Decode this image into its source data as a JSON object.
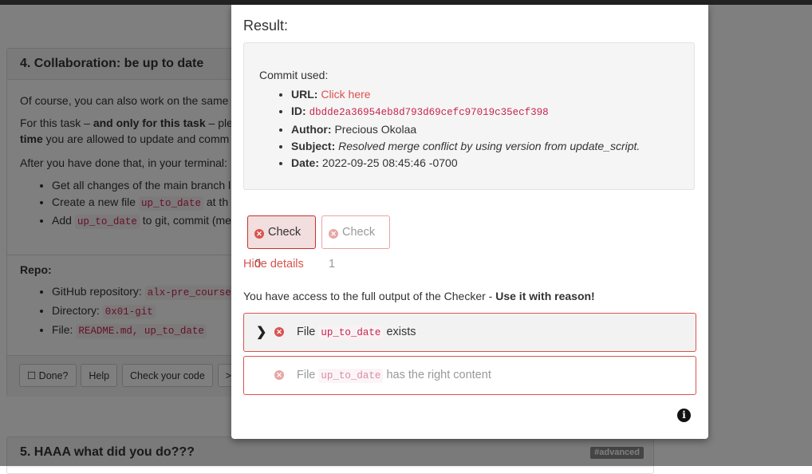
{
  "background": {
    "section4": {
      "title": "4. Collaboration: be up to date",
      "intro": "Of course, you can also work on the same",
      "task_prefix": "For this task – ",
      "task_bold": "and only for this task",
      "task_rest": " – plea",
      "task_line2_bold": "time",
      "task_line2_rest": " you are allowed to update and comm",
      "after": "After you have done that, in your terminal:",
      "steps": [
        {
          "text": "Get all changes of the main branch l"
        },
        {
          "pre": "Create a new file ",
          "code": "up_to_date",
          "post": " at th"
        },
        {
          "pre": "Add ",
          "code": "up_to_date",
          "post": " to git, commit (me"
        }
      ],
      "repo_label": "Repo:",
      "repo_items": [
        {
          "label": "GitHub repository: ",
          "code": "alx-pre_course"
        },
        {
          "label": "Directory: ",
          "code": "0x01-git"
        },
        {
          "label": "File: ",
          "code": "README.md, up_to_date"
        }
      ],
      "buttons": {
        "done": "☐ Done?",
        "help": "Help",
        "check": "Check your code",
        "more": ">_"
      }
    },
    "section5": {
      "title": "5. HAAA what did you do???",
      "badge": "#advanced"
    }
  },
  "modal": {
    "result_title": "Result:",
    "commit_label": "Commit used:",
    "commit": {
      "url_label": "URL:",
      "url_text": "Click here",
      "id_label": "ID:",
      "id": "dbdde2a36954eb8d793d69cefc97019c35ecf398",
      "author_label": "Author:",
      "author": "Precious Okolaa",
      "subject_label": "Subject:",
      "subject": "Resolved merge conflict by using version from update_script.",
      "date_label": "Date:",
      "date": "2022-09-25 08:45:46 -0700"
    },
    "checks": [
      {
        "label": "Check 0",
        "icon": "x-circle-icon",
        "active": true
      },
      {
        "label": "Check 1",
        "icon": "x-circle-icon",
        "active": false
      }
    ],
    "hide_details": "Hide details",
    "access_text": "You have access to the full output of the Checker - ",
    "access_bold": "Use it with reason!",
    "results": [
      {
        "pre": "File ",
        "code": "up_to_date",
        "post": " exists"
      },
      {
        "pre": "File ",
        "code": "up_to_date",
        "post": " has the right content"
      }
    ]
  },
  "colors": {
    "danger": "#d9534f",
    "code": "#c7254e",
    "overlay": "rgba(0,0,0,0.5)"
  }
}
